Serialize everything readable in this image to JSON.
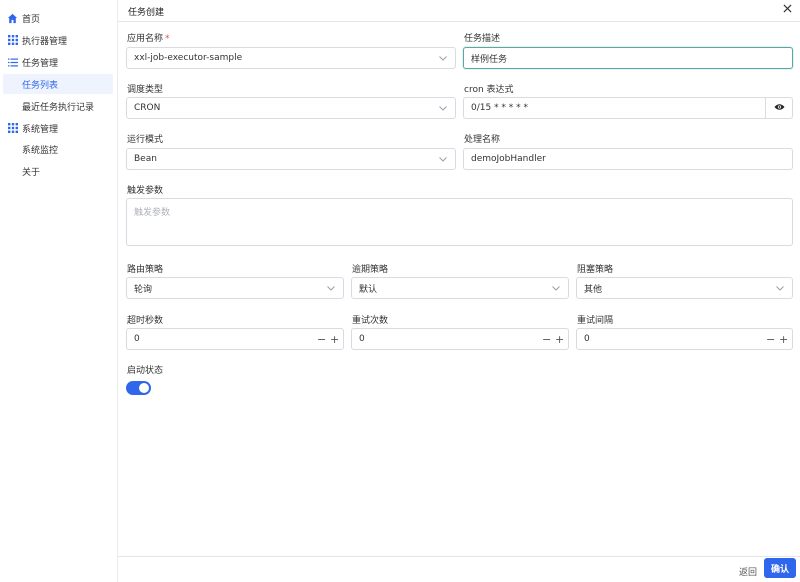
{
  "sidebar": {
    "items": [
      {
        "label": "首页",
        "icon": "home-icon"
      },
      {
        "label": "执行器管理",
        "icon": "grid-icon"
      },
      {
        "label": "任务管理",
        "icon": "list-icon"
      },
      {
        "label": "任务列表"
      },
      {
        "label": "最近任务执行记录"
      },
      {
        "label": "系统管理",
        "icon": "grid-icon"
      },
      {
        "label": "系统监控"
      },
      {
        "label": "关于"
      }
    ]
  },
  "dialog": {
    "title": "任务创建",
    "fields": {
      "app_name": {
        "label": "应用名称",
        "required_mark": "*",
        "value": "xxl-job-executor-sample"
      },
      "task_desc": {
        "label": "任务描述",
        "value": "样例任务"
      },
      "schedule_type": {
        "label": "调度类型",
        "value": "CRON"
      },
      "cron": {
        "label": "cron 表达式",
        "value": "0/15 * * * * *"
      },
      "run_mode": {
        "label": "运行模式",
        "value": "Bean"
      },
      "handler": {
        "label": "处理名称",
        "value": "demoJobHandler"
      },
      "trigger_params": {
        "label": "触发参数",
        "placeholder": "触发参数"
      },
      "route_strategy": {
        "label": "路由策略",
        "value": "轮询"
      },
      "misfire_strategy": {
        "label": "逾期策略",
        "value": "默认"
      },
      "block_strategy": {
        "label": "阻塞策略",
        "value": "其他"
      },
      "timeout": {
        "label": "超时秒数",
        "value": "0"
      },
      "retry_count": {
        "label": "重试次数",
        "value": "0"
      },
      "retry_interval": {
        "label": "重试间隔",
        "value": "0"
      },
      "start_status": {
        "label": "启动状态",
        "enabled": true
      }
    },
    "stepper": {
      "minus": "−",
      "plus": "+"
    },
    "footer": {
      "back_label": "返回",
      "confirm_label": "确认"
    }
  },
  "colors": {
    "primary": "#2f66ec",
    "active_bg": "#eef3fe",
    "focus_border": "#5aa7a3",
    "required": "#e34d4d"
  }
}
